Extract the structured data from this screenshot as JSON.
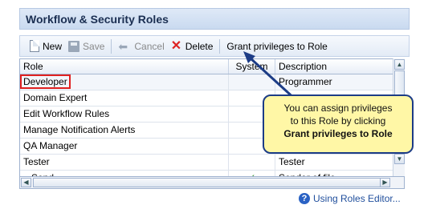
{
  "panel": {
    "title": "Workflow & Security Roles"
  },
  "toolbar": {
    "new_label": "New",
    "save_label": "Save",
    "cancel_label": "Cancel",
    "delete_label": "Delete",
    "grant_label": "Grant privileges to Role"
  },
  "grid": {
    "columns": {
      "role": "Role",
      "system": "System",
      "description": "Description"
    },
    "rows": [
      {
        "role": "Developer",
        "system": "",
        "description": "Programmer"
      },
      {
        "role": "Domain Expert",
        "system": "",
        "description": ""
      },
      {
        "role": "Edit Workflow Rules",
        "system": "",
        "description": ""
      },
      {
        "role": "Manage Notification Alerts",
        "system": "",
        "description": ""
      },
      {
        "role": "QA Manager",
        "system": "",
        "description": ""
      },
      {
        "role": "Tester",
        "system": "",
        "description": "Tester"
      },
      {
        "role": "...Send...",
        "system": "✓",
        "description": "Sender of file ...."
      }
    ]
  },
  "callout": {
    "line1": "You can assign privileges",
    "line2": "to this Role by clicking",
    "bold": "Grant privileges to Role"
  },
  "help": {
    "label": "Using Roles Editor..."
  },
  "colors": {
    "callout_bg": "#fff7a6",
    "callout_border": "#1c3c86",
    "selection_outline": "#e02020"
  }
}
